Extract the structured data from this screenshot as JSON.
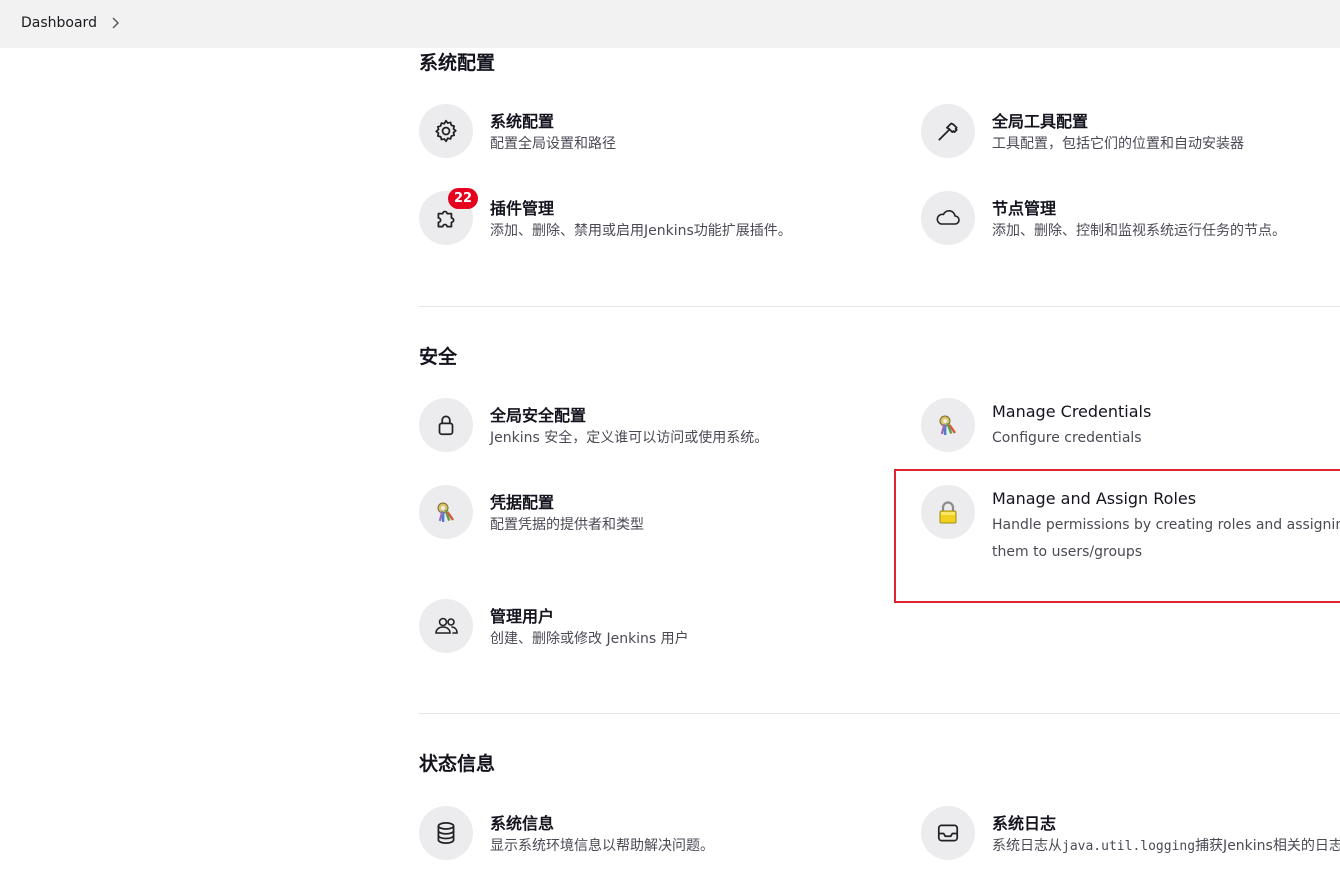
{
  "breadcrumb": {
    "dashboard": "Dashboard"
  },
  "sections": {
    "system_config": {
      "title": "系统配置",
      "items": [
        {
          "title": "系统配置",
          "desc": "配置全局设置和路径",
          "icon": "gear-icon"
        },
        {
          "title": "全局工具配置",
          "desc": "工具配置，包括它们的位置和自动安装器",
          "icon": "hammer-icon"
        },
        {
          "title": "插件管理",
          "desc": "添加、删除、禁用或启用Jenkins功能扩展插件。",
          "icon": "puzzle-icon",
          "badge": "22"
        },
        {
          "title": "节点管理",
          "desc": "添加、删除、控制和监视系统运行任务的节点。",
          "icon": "cloud-icon"
        }
      ]
    },
    "security": {
      "title": "安全",
      "items": [
        {
          "title": "全局安全配置",
          "desc": "Jenkins 安全，定义谁可以访问或使用系统。",
          "icon": "lock-icon"
        },
        {
          "title": "Manage Credentials",
          "desc": "Configure credentials",
          "icon": "credentials-keys-icon"
        },
        {
          "title": "凭据配置",
          "desc": "配置凭据的提供者和类型",
          "icon": "credentials-keys-icon"
        },
        {
          "title": "Manage and Assign Roles",
          "desc": "Handle permissions by creating roles and assigning them to users/groups",
          "icon": "yellow-padlock-icon"
        },
        {
          "title": "管理用户",
          "desc": "创建、删除或修改 Jenkins 用户",
          "icon": "users-icon"
        }
      ]
    },
    "status": {
      "title": "状态信息",
      "items": [
        {
          "title": "系统信息",
          "desc": "显示系统环境信息以帮助解决问题。",
          "icon": "database-icon"
        },
        {
          "title": "系统日志",
          "desc_prefix": "系统日志从",
          "desc_code": "java.util.logging",
          "desc_suffix": "捕获Jenkins相关的日志信息。",
          "icon": "inbox-icon"
        }
      ]
    }
  },
  "colors": {
    "highlight": "#e0232e",
    "badge": "#e6001f",
    "icon_bg": "#ececef"
  }
}
